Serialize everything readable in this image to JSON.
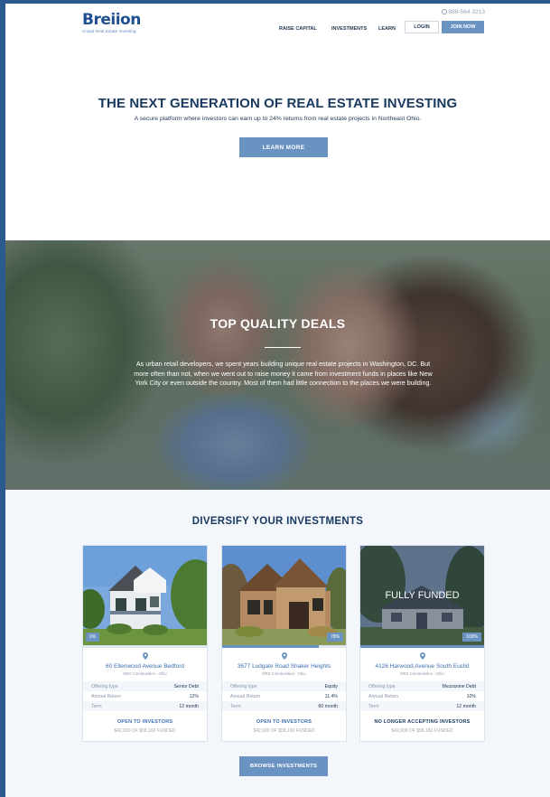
{
  "header": {
    "logo_text": "Breiion",
    "logo_tagline": "Crowd Real Estate Investing",
    "phone": "888-564-3213",
    "nav": [
      "RAISE CAPITAL",
      "INVESTMENTS",
      "LEARN"
    ],
    "login_label": "LOGIN",
    "join_label": "JOIN NOW"
  },
  "hero": {
    "title": "THE NEXT GENERATION OF REAL ESTATE INVESTING",
    "subtitle": "A secure platform where investors can earn up to 24% returns from real estate projects in Northeast Ohio.",
    "button": "LEARN MORE"
  },
  "deals": {
    "title": "TOP QUALITY DEALS",
    "text": "As urban retail developers, we spent years building unique real estate projects in Washington, DC. But more often than not, when we went out to raise money it came from investment funds in places like New York City or even outside the country. Most of them had little connection to the places we were building."
  },
  "investments": {
    "title": "DIVERSIFY YOUR INVESTMENTS",
    "browse_label": "BROWSE INVESTMENTS",
    "field_labels": {
      "offering": "Offering type",
      "return": "Annual Return",
      "term": "Term"
    },
    "cards": [
      {
        "progress_label": "0%",
        "progress": 0,
        "name": "60 Ellenwood Avenue Bedford",
        "location": "NRS Communities - Ohio",
        "offering_type": "Senior Debt",
        "annual_return": "12%",
        "term": "12 month",
        "status": "OPEN TO INVESTORS",
        "funded": "$42,000 OF $58,160 FUNDED",
        "overlay": ""
      },
      {
        "progress_label": "78%",
        "progress": 78,
        "name": "3677 Ludgate Road Shaker Heights",
        "location": "NRS Communities - Ohio",
        "offering_type": "Equity",
        "annual_return": "11.4%",
        "term": "60 month",
        "status": "OPEN TO INVESTORS",
        "funded": "$42,000 OF $58,160 FUNDED",
        "overlay": ""
      },
      {
        "progress_label": "100%",
        "progress": 100,
        "name": "4126 Harwood Avenue South Euclid",
        "location": "NRS Communities - Ohio",
        "offering_type": "Mezzanine Debt",
        "annual_return": "10%",
        "term": "12 month",
        "status": "NO LONGER ACCEPTING INVESTORS",
        "funded": "$42,000 OF $58,160 FUNDED",
        "overlay": "FULLY FUNDED"
      }
    ]
  },
  "colors": {
    "brand": "#1f4f8f",
    "accent": "#6b93c2",
    "heading": "#1a3a60"
  }
}
